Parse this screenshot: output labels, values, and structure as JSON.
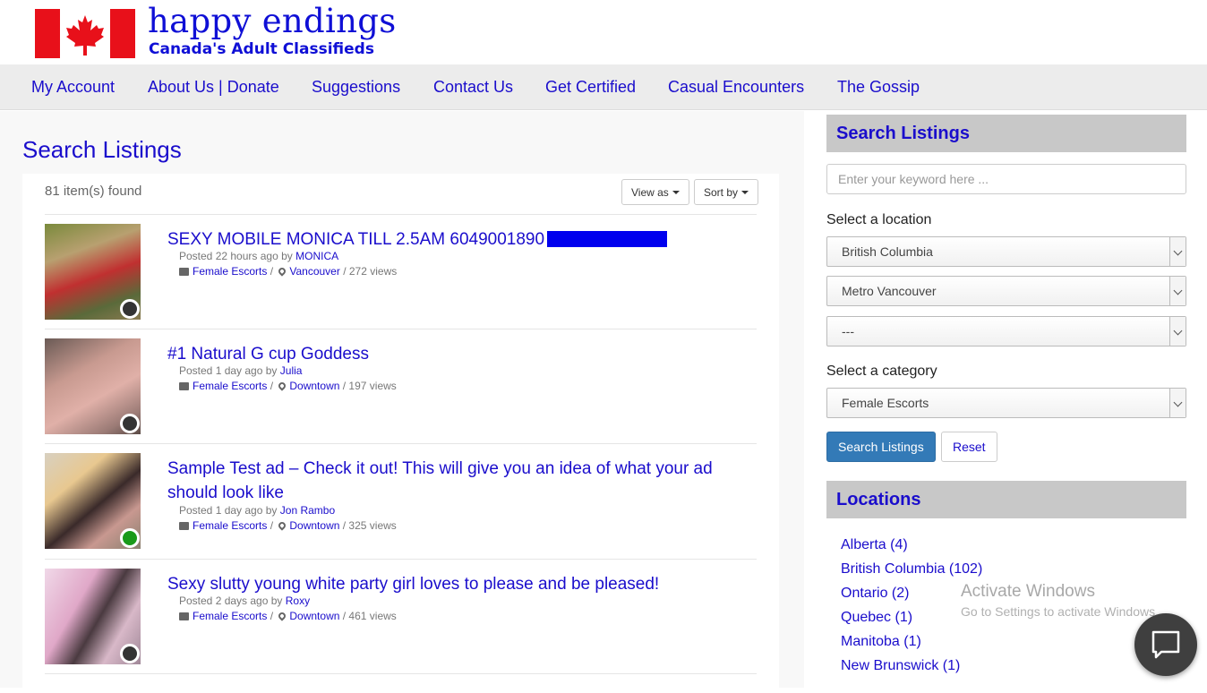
{
  "brand": {
    "title": "happy endings",
    "subtitle": "Canada's Adult Classifieds"
  },
  "nav": [
    "My Account",
    "About Us | Donate",
    "Suggestions",
    "Contact Us",
    "Get Certified",
    "Casual Encounters",
    "The Gossip"
  ],
  "main": {
    "title": "Search Listings",
    "count": "81 item(s) found",
    "view_as": "View as",
    "sort_by": "Sort by",
    "listings": [
      {
        "title": "SEXY MOBILE MONICA TILL 2.5AM 6049001890",
        "posted": "Posted 22 hours ago by",
        "author": "MONICA",
        "category": "Female Escorts",
        "location": "Vancouver",
        "views": "272 views",
        "status_color": "#333333"
      },
      {
        "title": "#1 Natural G cup Goddess",
        "posted": "Posted 1 day ago by",
        "author": "Julia",
        "category": "Female Escorts",
        "location": "Downtown",
        "views": "197 views",
        "status_color": "#333333"
      },
      {
        "title": "Sample Test ad – Check it out! This will give you an idea of what your ad should look like",
        "posted": "Posted 1 day ago by",
        "author": "Jon Rambo",
        "category": "Female Escorts",
        "location": "Downtown",
        "views": "325 views",
        "status_color": "#1a9a1a"
      },
      {
        "title": "Sexy slutty young white party girl loves to please and be pleased!",
        "posted": "Posted 2 days ago by",
        "author": "Roxy",
        "category": "Female Escorts",
        "location": "Downtown",
        "views": "461 views",
        "status_color": "#333333"
      }
    ]
  },
  "sidebar": {
    "search_title": "Search Listings",
    "keyword_placeholder": "Enter your keyword here ...",
    "location_label": "Select a location",
    "location_selects": [
      "British Columbia",
      "Metro Vancouver",
      "---"
    ],
    "category_label": "Select a category",
    "category_value": "Female Escorts",
    "search_button": "Search Listings",
    "reset_button": "Reset",
    "locations_title": "Locations",
    "locations": [
      "Alberta (4)",
      "British Columbia (102)",
      "Ontario (2)",
      "Quebec (1)",
      "Manitoba (1)",
      "New Brunswick (1)"
    ]
  },
  "watermark": {
    "line1": "Activate Windows",
    "line2": "Go to Settings to activate Windows."
  },
  "colors": {
    "link": "#1a0dcc",
    "brand": "#0f0fd6",
    "nav_bg": "#ececec",
    "primary": "#337ab7"
  }
}
